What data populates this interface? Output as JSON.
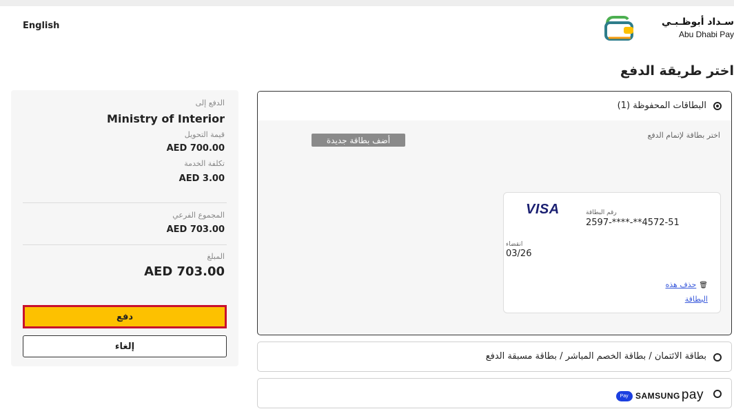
{
  "header": {
    "language": "English",
    "brand_ar": "سـداد أبوظـبـي",
    "brand_en": "Abu Dhabi Pay",
    "brand_color": "#fdc100"
  },
  "page_title": "اختر طريقة الدفع",
  "summary": {
    "pay_to_label": "الدفع إلى",
    "pay_to_value": "Ministry of Interior",
    "transfer_label": "قيمة التحويل",
    "transfer_value": "AED 700.00",
    "fee_label": "تكلفة الخدمة",
    "fee_value": "AED 3.00",
    "subtotal_label": "المجموع الفرعي",
    "subtotal_value": "AED 703.00",
    "amount_label": "المبلغ",
    "amount_value": "AED 703.00",
    "pay_button": "دفع",
    "cancel_button": "إلغاء"
  },
  "saved_cards": {
    "label": "البطاقات المحفوظة (1)",
    "selected": true,
    "subtitle": "اختر بطاقة لإتمام الدفع",
    "add_button": "أضف بطاقة جديدة",
    "card": {
      "brand": "VISA",
      "number_label": "رقم البطاقة",
      "number": "2597-****-**4572-51",
      "expiry_label": "انقضاء",
      "expiry": "03/26",
      "delete_link": "حذف هذه البطاقة",
      "delete_icon": "trash-icon"
    }
  },
  "options": [
    {
      "label": "بطاقة الائتمان / بطاقة الخصم المباشر / بطاقة مسبقة الدفع",
      "selected": false
    },
    {
      "label": "SAMSUNG",
      "label_pay": "pay",
      "badge": "Pay",
      "selected": false
    }
  ]
}
